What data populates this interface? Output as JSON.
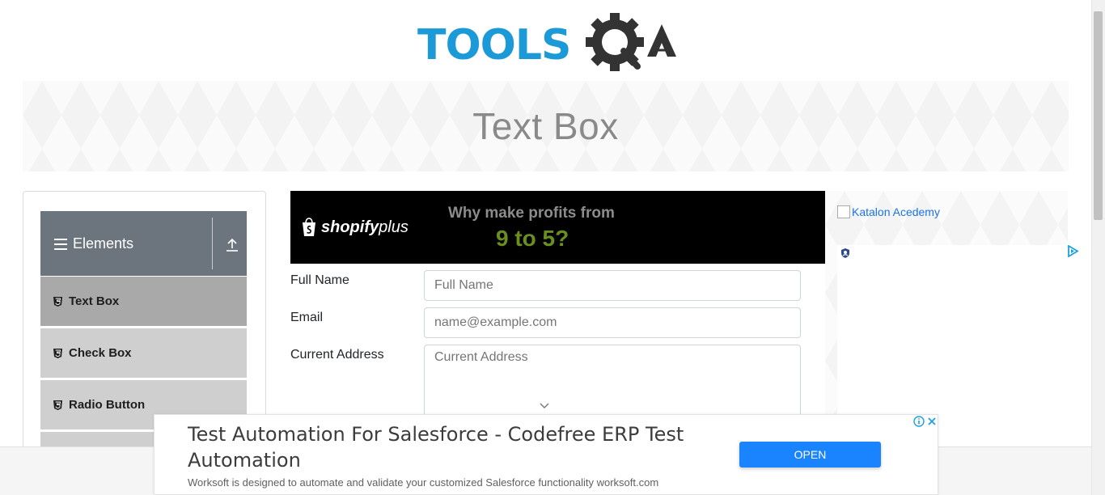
{
  "logo": {
    "text": "TOOLS",
    "suffix": "QA"
  },
  "banner": {
    "title": "Text Box"
  },
  "sidebar": {
    "group_title": "Elements",
    "items": [
      {
        "label": "Text Box",
        "active": true
      },
      {
        "label": "Check Box",
        "active": false
      },
      {
        "label": "Radio Button",
        "active": false
      }
    ]
  },
  "top_ad": {
    "brand": "shopify",
    "brand_suffix": "plus",
    "headline1": "Why make profits from",
    "headline2": "9 to 5?"
  },
  "form": {
    "full_name": {
      "label": "Full Name",
      "placeholder": "Full Name",
      "value": ""
    },
    "email": {
      "label": "Email",
      "placeholder": "name@example.com",
      "value": ""
    },
    "current_address": {
      "label": "Current Address",
      "placeholder": "Current Address",
      "value": ""
    }
  },
  "right_ad": {
    "link_text": "Katalon Acedemy"
  },
  "bottom_ad": {
    "title": "Test Automation For Salesforce - Codefree ERP Test Automation",
    "description": "Worksoft is designed to automate and validate your customized Salesforce functionality worksoft.com",
    "button_label": "OPEN"
  },
  "colors": {
    "accent_blue": "#1b9ad7",
    "header_gray": "#6c757d",
    "active_item": "#a9a9a9",
    "item_bg": "#cfcfcf",
    "open_button": "#1a84ff",
    "ad_green": "#6b8f1e"
  },
  "icons": [
    "gear-icon",
    "menu-icon",
    "upload-icon",
    "html5-icon",
    "chevron-down-icon",
    "adchoices-icon",
    "info-icon",
    "close-icon",
    "shopping-bag-icon"
  ]
}
